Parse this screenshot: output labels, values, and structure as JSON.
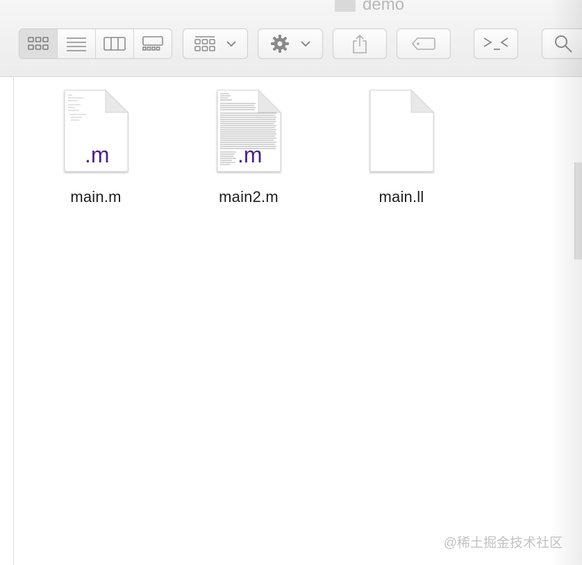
{
  "window": {
    "title": "demo"
  },
  "toolbar": {
    "view_modes": [
      "icon-view",
      "list-view",
      "column-view",
      "gallery-view"
    ],
    "active_view": "icon-view",
    "buttons": [
      "group-button",
      "action-button",
      "share-button",
      "tags-button",
      "terminal-button",
      "search-button"
    ]
  },
  "files": [
    {
      "name": "main.m",
      "ext": ".m",
      "type": "objc-source"
    },
    {
      "name": "main2.m",
      "ext": ".m",
      "type": "objc-source"
    },
    {
      "name": "main.ll",
      "ext": "",
      "type": "generic"
    }
  ],
  "watermark": "@稀土掘金技术社区",
  "colors": {
    "ext_label": "#4a2388",
    "toolbar_bg": "#ececec",
    "border": "#cdcdcd"
  }
}
